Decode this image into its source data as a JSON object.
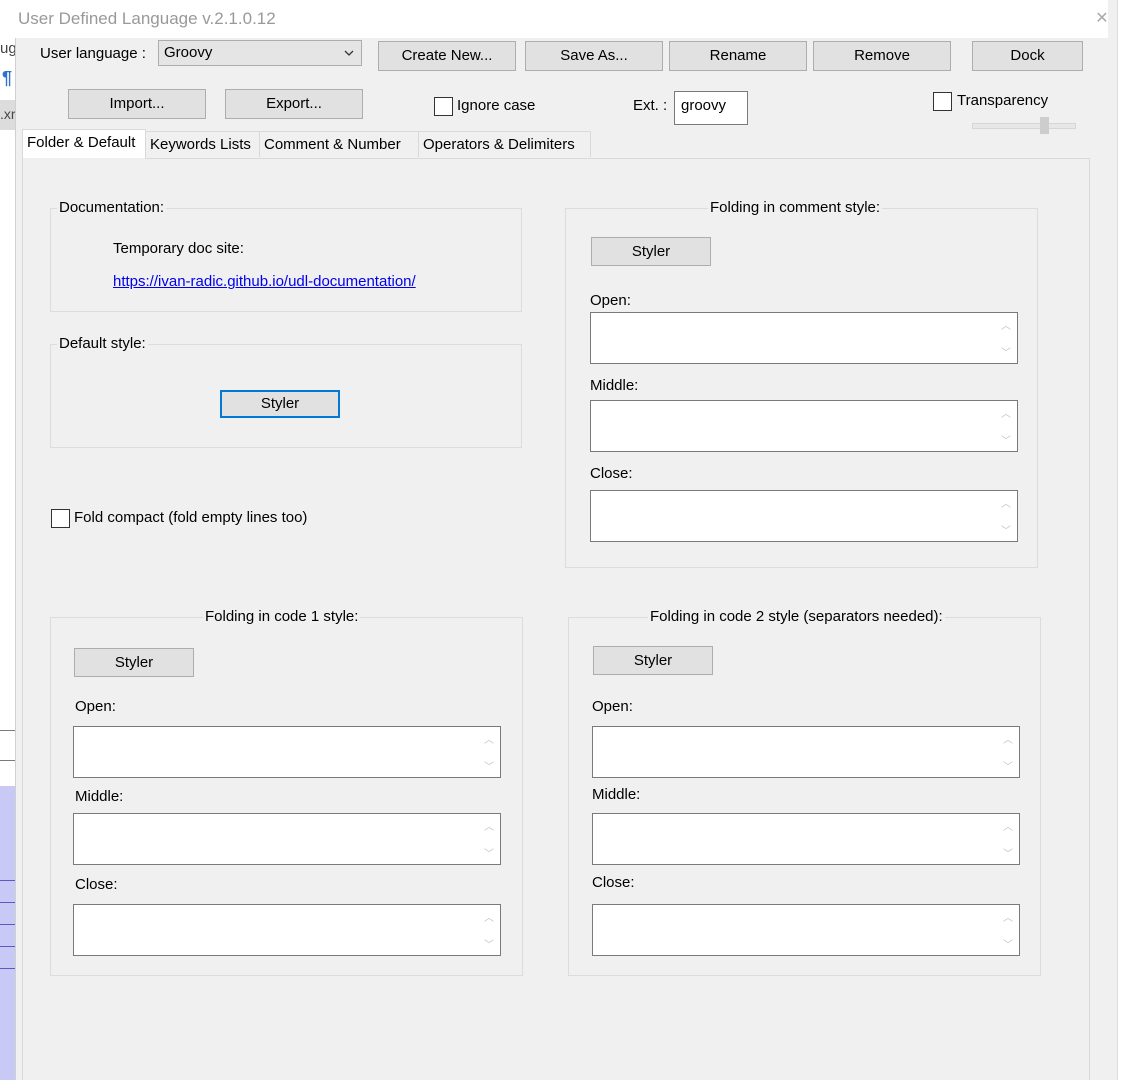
{
  "window": {
    "title": "User Defined Language v.2.1.0.12",
    "close_glyph": "✕"
  },
  "background": {
    "fragment_top": "ug",
    "fragment_mark": "¶",
    "fragment_tab": ".xr"
  },
  "toolbar": {
    "user_language_label": "User language :",
    "user_language_value": "Groovy",
    "create_new": "Create New...",
    "save_as": "Save As...",
    "rename": "Rename",
    "remove": "Remove",
    "dock": "Dock",
    "import": "Import...",
    "export": "Export...",
    "ignore_case": "Ignore case",
    "ext_label": "Ext. :",
    "ext_value": "groovy",
    "transparency": "Transparency"
  },
  "tabs": [
    {
      "label": "Folder & Default",
      "active": true
    },
    {
      "label": "Keywords Lists",
      "active": false
    },
    {
      "label": "Comment & Number",
      "active": false
    },
    {
      "label": "Operators & Delimiters",
      "active": false
    }
  ],
  "documentation": {
    "legend": "Documentation:",
    "temp_label": "Temporary doc site:",
    "link": "https://ivan-radic.github.io/udl-documentation/"
  },
  "default_style": {
    "legend": "Default style:",
    "styler": "Styler"
  },
  "fold_compact": {
    "label": "Fold compact (fold empty lines too)"
  },
  "comment_style": {
    "legend": "Folding in comment style:",
    "styler": "Styler",
    "open": "Open:",
    "middle": "Middle:",
    "close": "Close:"
  },
  "code1_style": {
    "legend": "Folding in code 1 style:",
    "styler": "Styler",
    "open": "Open:",
    "middle": "Middle:",
    "close": "Close:"
  },
  "code2_style": {
    "legend": "Folding in code 2 style (separators needed):",
    "styler": "Styler",
    "open": "Open:",
    "middle": "Middle:",
    "close": "Close:"
  },
  "icons": {
    "dropdown": "chevron-down-icon",
    "scroll_up": "chevron-up-icon",
    "scroll_down": "chevron-down-icon"
  },
  "colors": {
    "focus": "#0078d7",
    "link": "#0000ee",
    "dialog_bg": "#f0f0f0"
  }
}
